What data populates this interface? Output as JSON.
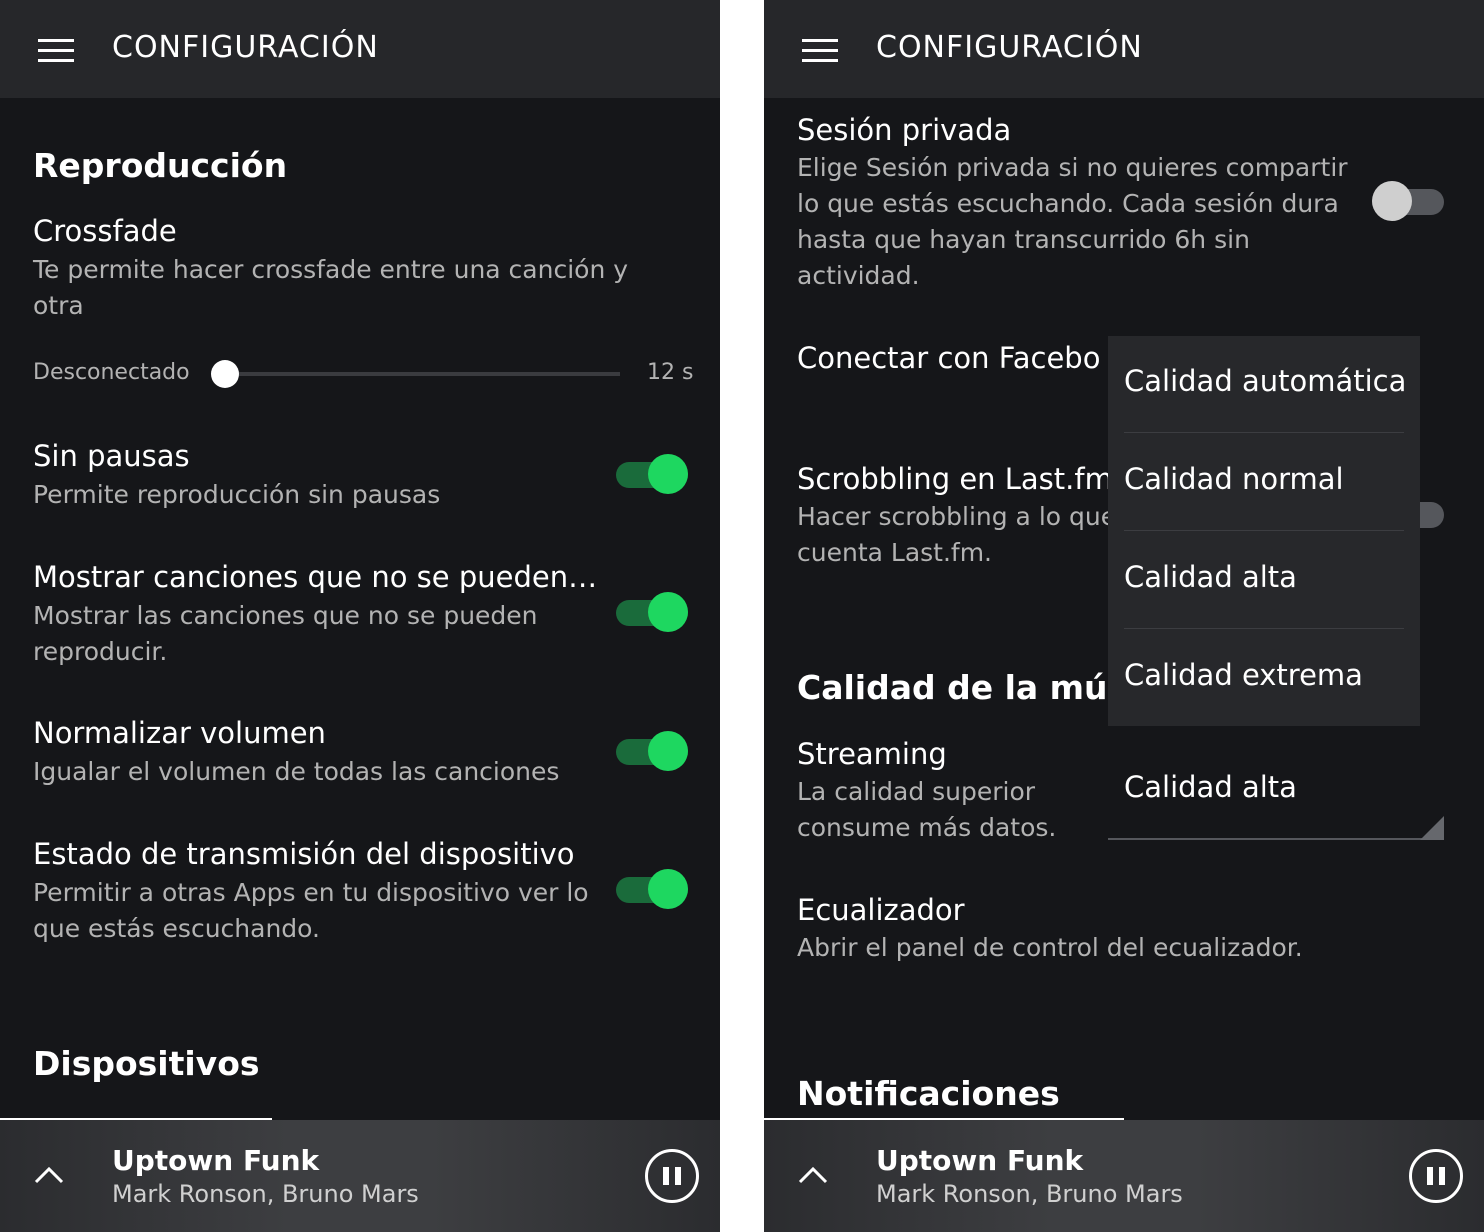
{
  "left": {
    "header": {
      "title": "CONFIGURACIÓN"
    },
    "sections": {
      "playback": "Reproducción",
      "devices": "Dispositivos"
    },
    "crossfade": {
      "title": "Crossfade",
      "desc": "Te permite hacer crossfade entre una canción y otra",
      "min_label": "Desconectado",
      "max_label": "12 s",
      "value_fraction": 0.0
    },
    "items": [
      {
        "title": "Sin pausas",
        "desc": "Permite reproducción sin pausas",
        "on": true
      },
      {
        "title": "Mostrar canciones que no se pueden…",
        "desc": "Mostrar las canciones que no se pueden reproducir.",
        "on": true
      },
      {
        "title": "Normalizar volumen",
        "desc": "Igualar el volumen de todas las canciones",
        "on": true
      },
      {
        "title": "Estado de transmisión del dispositivo",
        "desc": "Permitir a otras Apps en tu dispositivo ver lo que estás escuchando.",
        "on": true
      }
    ],
    "player": {
      "title": "Uptown Funk",
      "artist": "Mark Ronson, Bruno Mars"
    }
  },
  "right": {
    "header": {
      "title": "CONFIGURACIÓN"
    },
    "private_session": {
      "title": "Sesión privada",
      "desc": "Elige Sesión privada si no quieres compartir lo que estás escuchando. Cada sesión dura hasta que hayan transcurrido 6h sin actividad.",
      "on": false
    },
    "facebook": {
      "title": "Conectar con Facebo"
    },
    "scrobbling": {
      "title": "Scrobbling en Last.fm",
      "desc": "Hacer scrobbling a lo que cuenta Last.fm."
    },
    "music_quality": {
      "title": "Calidad de la músi"
    },
    "streaming": {
      "title": "Streaming",
      "desc": "La calidad superior consume más datos.",
      "selected": "Calidad alta"
    },
    "equalizer": {
      "title": "Ecualizador",
      "desc": "Abrir el panel de control del ecualizador."
    },
    "notifications": {
      "title": "Notificaciones"
    },
    "dropdown_options": [
      "Calidad automática",
      "Calidad normal",
      "Calidad alta",
      "Calidad extrema"
    ],
    "player": {
      "title": "Uptown Funk",
      "artist": "Mark Ronson, Bruno Mars"
    }
  },
  "colors": {
    "accent_green": "#1ed760",
    "background": "#151619",
    "header": "#26272a"
  }
}
